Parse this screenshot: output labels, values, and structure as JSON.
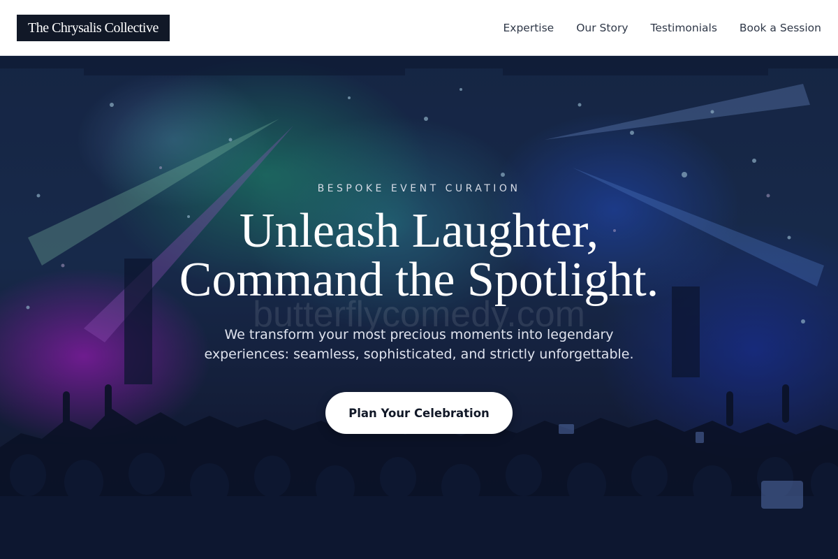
{
  "header": {
    "logo": "The Chrysalis Collective",
    "nav": [
      "Expertise",
      "Our Story",
      "Testimonials",
      "Book a Session"
    ]
  },
  "hero": {
    "eyebrow": "BESPOKE EVENT CURATION",
    "headline_line1": "Unleash Laughter,",
    "headline_line2": "Command the Spotlight.",
    "watermark": "butterflycomedy.com",
    "subtitle_line1": "We transform your most precious moments into legendary",
    "subtitle_line2": "experiences: seamless, sophisticated, and strictly unforgettable.",
    "cta_label": "Plan Your Celebration"
  },
  "colors": {
    "logo_bg": "#111827",
    "nav_text": "#2f3848",
    "cta_bg": "#ffffff",
    "cta_text": "#111827"
  }
}
